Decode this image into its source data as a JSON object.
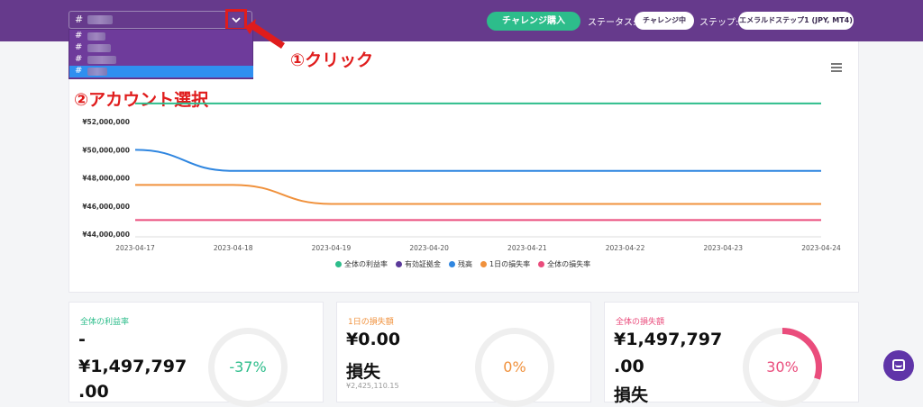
{
  "topbar": {
    "account_hash": "#",
    "buy_label": "チャレンジ購入",
    "status_label": "ステータス:",
    "status_value": "チャレンジ中",
    "step_label": "ステップ:",
    "step_value": "エメラルドステップ1 (JPY, MT4)"
  },
  "dropdown": {
    "items": [
      "#",
      "#",
      "#",
      "#"
    ],
    "selected_index": 3
  },
  "annotations": {
    "click": "①クリック",
    "select": "②アカウント選択"
  },
  "colors": {
    "brand": "#663a8c",
    "accent": "#2dbd8b",
    "annotation": "#e01c1c",
    "selected": "#2f8ff0"
  },
  "chart_data": {
    "type": "line",
    "x": [
      "2023-04-17",
      "2023-04-18",
      "2023-04-19",
      "2023-04-20",
      "2023-04-21",
      "2023-04-22",
      "2023-04-23",
      "2023-04-24"
    ],
    "y_ticks": [
      "¥44,000,000",
      "¥46,000,000",
      "¥48,000,000",
      "¥50,000,000",
      "¥52,000,000"
    ],
    "ylim": [
      44000000,
      54000000
    ],
    "series": [
      {
        "name": "全体の利益率",
        "color": "#2dbd8b",
        "values": [
          53300000,
          53300000,
          53300000,
          53300000,
          53300000,
          53300000,
          53300000,
          53300000
        ]
      },
      {
        "name": "有効証拠金",
        "color": "#5b3a9a",
        "values": []
      },
      {
        "name": "残高",
        "color": "#2f86e0",
        "values": [
          50000000,
          48500000,
          48500000,
          48500000,
          48500000,
          48500000,
          48500000,
          48500000
        ]
      },
      {
        "name": "1日の損失率",
        "color": "#f0913c",
        "values": [
          47500000,
          47500000,
          46150000,
          46150000,
          46150000,
          46150000,
          46150000,
          46150000
        ]
      },
      {
        "name": "全体の損失率",
        "color": "#ea4c7c",
        "values": [
          45000000,
          45000000,
          45000000,
          45000000,
          45000000,
          45000000,
          45000000,
          45000000
        ]
      }
    ]
  },
  "cards": [
    {
      "title": "全体の利益率",
      "color": "#2dbd8b",
      "lines": [
        "-",
        "¥1,497,797",
        ".00"
      ],
      "sub": "",
      "ring_text": "-37%",
      "ring_fraction": 0
    },
    {
      "title": "1日の損失額",
      "color": "#f0913c",
      "lines": [
        "¥0.00",
        "損失"
      ],
      "sub": "¥2,425,110.15",
      "ring_text": "0%",
      "ring_fraction": 0
    },
    {
      "title": "全体の損失額",
      "color": "#ea4c7c",
      "lines": [
        "¥1,497,797",
        ".00",
        "損失"
      ],
      "sub": "",
      "ring_text": "30%",
      "ring_fraction": 0.3
    }
  ]
}
